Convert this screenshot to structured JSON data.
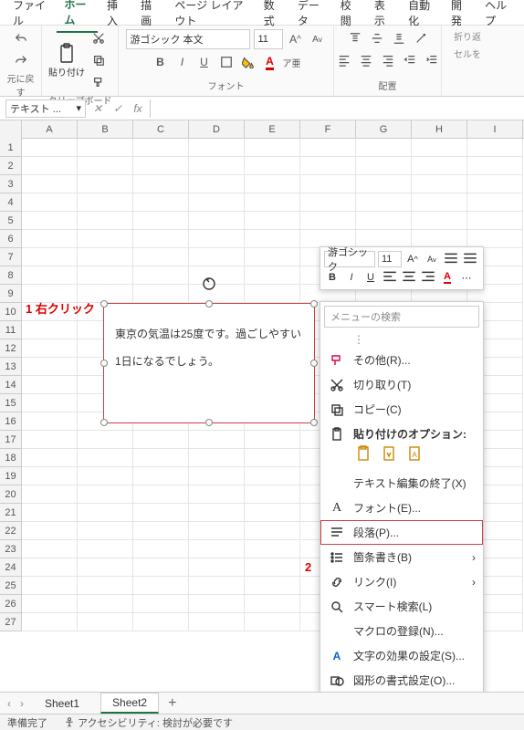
{
  "menus": {
    "file": "ファイル",
    "home": "ホーム",
    "insert": "挿入",
    "draw": "描画",
    "pagelayout": "ページ レイアウト",
    "formulas": "数式",
    "data": "データ",
    "review": "校閲",
    "view": "表示",
    "automate": "自動化",
    "developer": "開発",
    "help": "ヘルプ"
  },
  "ribbon": {
    "undo_group": "元に戻す",
    "clipboard_group": "クリップボード",
    "paste_label": "貼り付け",
    "font_group": "フォント",
    "font_name": "游ゴシック 本文",
    "font_size": "11",
    "align_group": "配置",
    "wrap": "折り返",
    "cell_merge": "セルを"
  },
  "namebox": "テキスト ...",
  "columns": [
    "A",
    "B",
    "C",
    "D",
    "E",
    "F",
    "G",
    "H",
    "I"
  ],
  "rows": [
    1,
    2,
    3,
    4,
    5,
    6,
    7,
    8,
    9,
    10,
    11,
    12,
    13,
    14,
    15,
    16,
    17,
    18,
    19,
    20,
    21,
    22,
    23,
    24,
    25,
    26,
    27
  ],
  "textbox": {
    "line1": "東京の気温は25度です。過ごしやすい",
    "line2": "1日になるでしょう。"
  },
  "anno": {
    "one": "1 右クリック",
    "two": "2"
  },
  "mini": {
    "font": "游ゴシック",
    "size": "11"
  },
  "ctx": {
    "search": "メニューの検索",
    "other": "その他(R)...",
    "cut": "切り取り(T)",
    "copy": "コピー(C)",
    "paste_header": "貼り付けのオプション:",
    "exit_edit": "テキスト編集の終了(X)",
    "font": "フォント(E)...",
    "paragraph": "段落(P)...",
    "bullets": "箇条書き(B)",
    "link": "リンク(I)",
    "smart": "スマート検索(L)",
    "macro": "マクロの登録(N)...",
    "effects": "文字の効果の設定(S)...",
    "format": "図形の書式設定(O)..."
  },
  "sheets": {
    "s1": "Sheet1",
    "s2": "Sheet2",
    "add": "+"
  },
  "status": {
    "ready": "準備完了",
    "access": "アクセシビリティ: 検討が必要です"
  }
}
